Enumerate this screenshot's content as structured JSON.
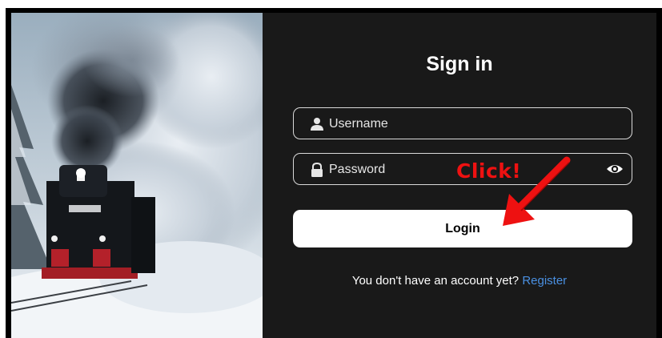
{
  "login_form": {
    "title": "Sign in",
    "username_placeholder": "Username",
    "password_placeholder": "Password",
    "login_label": "Login",
    "footer_text": "You don't have an account yet?",
    "register_link": "Register"
  },
  "annotation": {
    "text": "Click!",
    "color": "#ee1111"
  },
  "icons": {
    "username": "user-icon",
    "password": "lock-icon",
    "toggle": "eye-icon"
  },
  "colors": {
    "panel_bg": "#191919",
    "link": "#4a90e2",
    "button_bg": "#ffffff"
  }
}
